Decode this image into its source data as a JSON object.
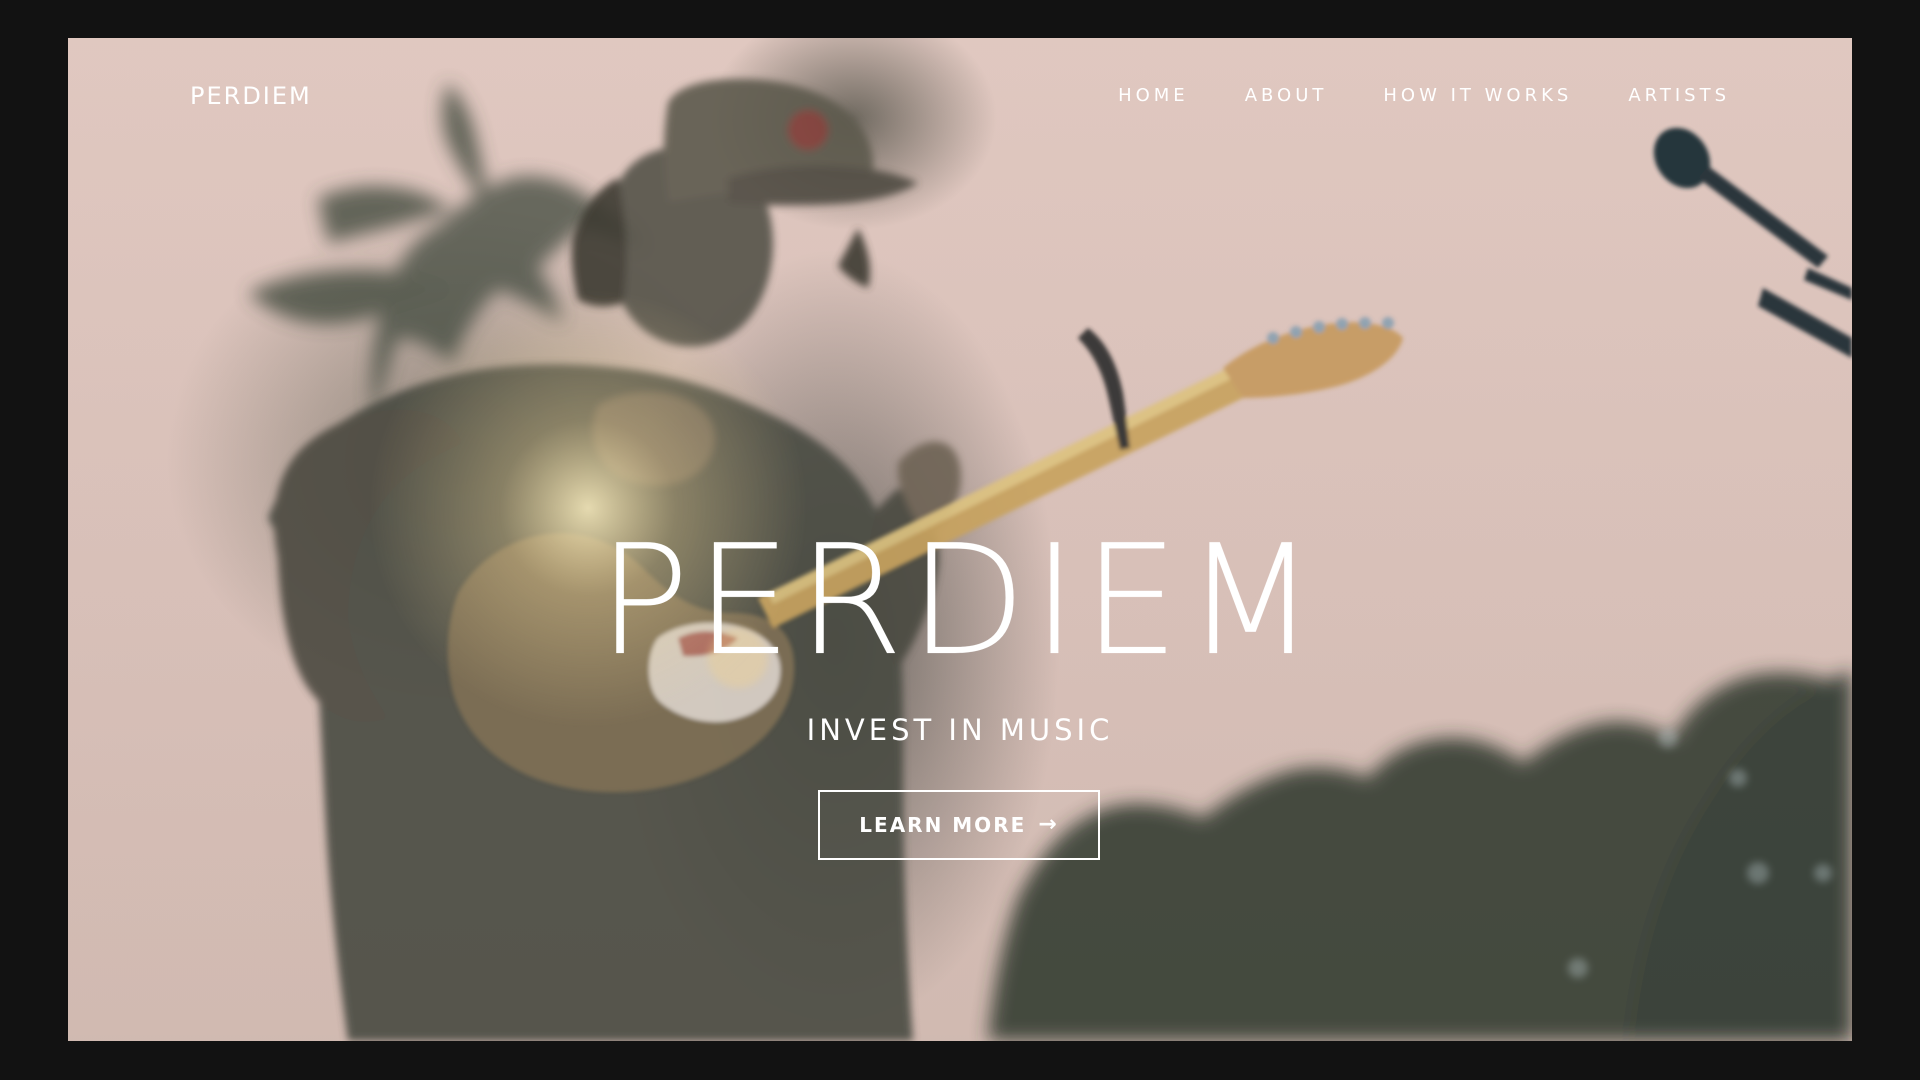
{
  "brand": {
    "name": "PERDIEM"
  },
  "nav": {
    "items": [
      {
        "label": "HOME"
      },
      {
        "label": "ABOUT"
      },
      {
        "label": "HOW IT WORKS"
      },
      {
        "label": "ARTISTS"
      }
    ]
  },
  "hero": {
    "title": "PERDIEM",
    "subtitle": "INVEST IN MUSIC",
    "cta_label": "LEARN MORE",
    "cta_icon": "arrow-right-icon"
  },
  "colors": {
    "page_background": "#121212",
    "hero_background": "#dcc4bd",
    "text": "#ffffff"
  }
}
